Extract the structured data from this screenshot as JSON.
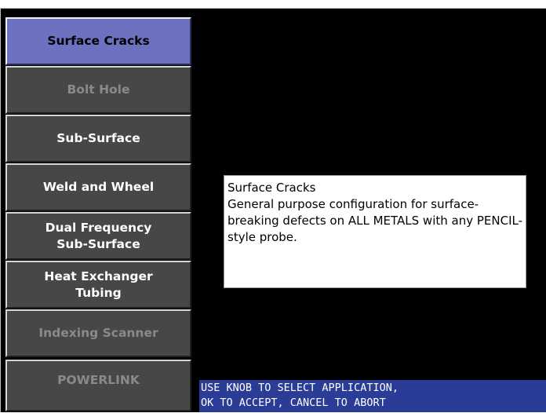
{
  "menu": {
    "items": [
      {
        "label": "Surface Cracks",
        "state": "selected"
      },
      {
        "label": "Bolt Hole",
        "state": "disabled"
      },
      {
        "label": "Sub-Surface",
        "state": "enabled"
      },
      {
        "label": "Weld and Wheel",
        "state": "enabled"
      },
      {
        "label": "Dual Frequency\nSub-Surface",
        "state": "enabled"
      },
      {
        "label": "Heat Exchanger\nTubing",
        "state": "enabled"
      },
      {
        "label": "Indexing Scanner",
        "state": "disabled"
      },
      {
        "label": "POWERLINK",
        "state": "disabled"
      }
    ]
  },
  "info": {
    "title": "Surface Cracks",
    "description": "General purpose configuration for surface-breaking defects on ALL METALS with any PENCIL-style probe."
  },
  "status": {
    "line1": "USE KNOB TO SELECT APPLICATION,",
    "line2": "OK TO ACCEPT, CANCEL TO ABORT"
  },
  "colors": {
    "screen_background": "#000000",
    "selected_button": "#6c72c0",
    "button_background": "#474747",
    "disabled_text": "#8a8a8a",
    "status_bar": "#2b3c97"
  }
}
